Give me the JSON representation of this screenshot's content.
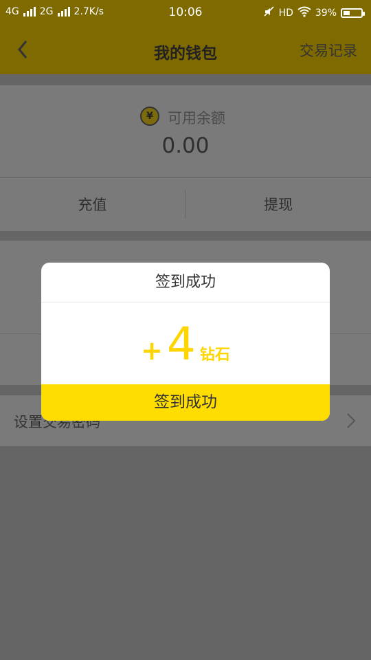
{
  "status_bar": {
    "network1": "4G",
    "network2": "2G",
    "speed": "2.7K/s",
    "time": "10:06",
    "hd": "HD",
    "battery_percent": "39%",
    "battery_level": 0.39
  },
  "nav": {
    "back_icon": "chevron-left-icon",
    "title": "我的钱包",
    "action": "交易记录"
  },
  "wallet": {
    "coin_icon": "yen-coin-icon",
    "coin_glyph": "¥",
    "balance_label": "可用余额",
    "balance_value": "0.00",
    "recharge_label": "充值",
    "withdraw_label": "提现"
  },
  "settings": {
    "set_password_label": "设置交易密码",
    "chevron_icon": "chevron-right-icon"
  },
  "modal": {
    "title": "签到成功",
    "reward_plus": "+",
    "reward_amount": "4",
    "reward_unit": "钻石",
    "button_label": "签到成功",
    "accent_color": "#FFDD00"
  }
}
